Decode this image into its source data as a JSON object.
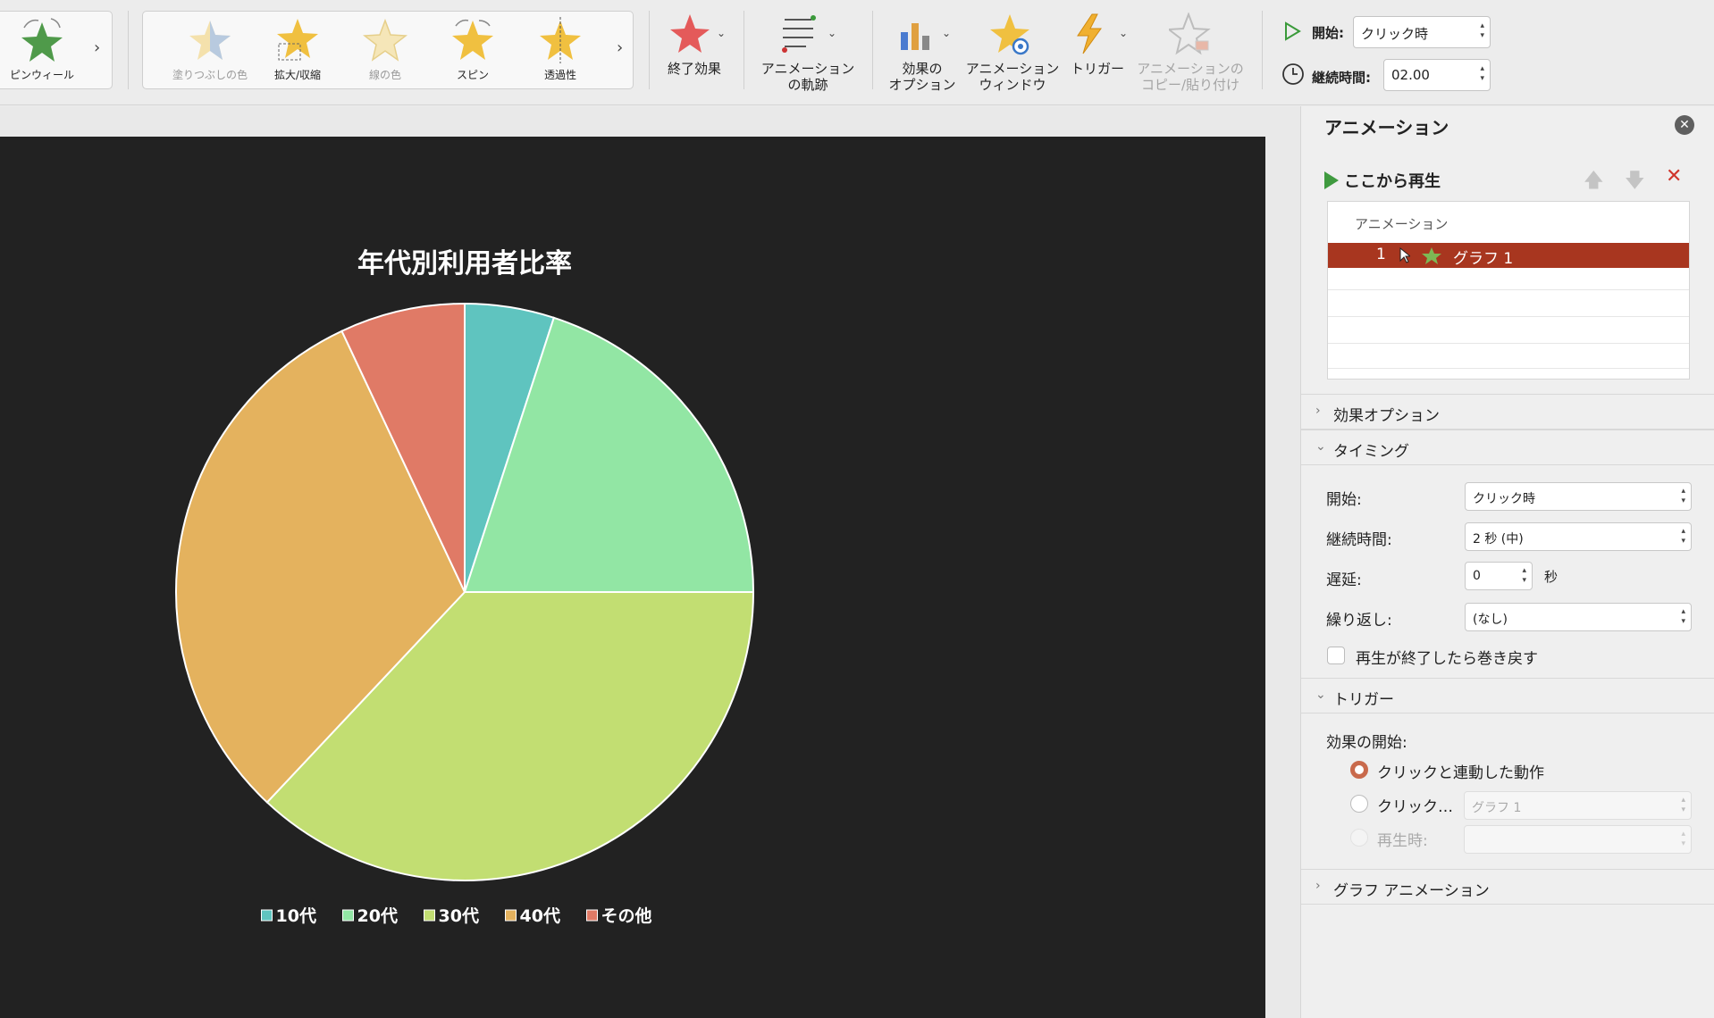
{
  "ribbon": {
    "pinwheel": {
      "label": "ピンウィール",
      "icon": "pinwheel-star-icon"
    },
    "emphasis": [
      {
        "label": "塗りつぶしの色",
        "icon": "fill-color-star-icon",
        "enabled": false
      },
      {
        "label": "拡大/収縮",
        "icon": "grow-shrink-star-icon",
        "enabled": true
      },
      {
        "label": "線の色",
        "icon": "line-color-star-icon",
        "enabled": false
      },
      {
        "label": "スピン",
        "icon": "spin-star-icon",
        "enabled": true
      },
      {
        "label": "透過性",
        "icon": "transparency-star-icon",
        "enabled": true
      }
    ],
    "exit_effect": {
      "label": "終了効果",
      "icon": "exit-star-icon"
    },
    "motion_path": {
      "label_line1": "アニメーション",
      "label_line2": "の軌跡",
      "icon": "motion-path-icon"
    },
    "effect_options": {
      "label_line1": "効果の",
      "label_line2": "オプション",
      "icon": "effect-options-chart-icon"
    },
    "animation_pane": {
      "label_line1": "アニメーション",
      "label_line2": "ウィンドウ",
      "icon": "animation-pane-star-icon"
    },
    "trigger": {
      "label": "トリガー",
      "icon": "lightning-icon"
    },
    "painter": {
      "label_line1": "アニメーションの",
      "label_line2": "コピー/貼り付け",
      "icon": "animation-painter-icon",
      "enabled": false
    },
    "start_label": "開始:",
    "start_value": "クリック時",
    "duration_label": "継続時間:",
    "duration_value": "02.00"
  },
  "slide": {
    "chart_title": "年代別利用者比率"
  },
  "chart_data": {
    "type": "pie",
    "title": "年代別利用者比率",
    "categories": [
      "10代",
      "20代",
      "30代",
      "40代",
      "その他"
    ],
    "values": [
      5,
      20,
      37,
      31,
      7
    ],
    "colors": [
      "#5fc4bf",
      "#92e6a4",
      "#c2de72",
      "#e4b25e",
      "#e07a66"
    ],
    "legend_position": "bottom",
    "start_angle_deg": 0,
    "direction": "clockwise",
    "background": "#222222",
    "text_color": "#ffffff"
  },
  "pane": {
    "title": "アニメーション",
    "play_from": "ここから再生",
    "list_header": "アニメーション",
    "selected_item": {
      "order": "1",
      "name": "グラフ 1"
    },
    "sections": {
      "effect_options": "効果オプション",
      "timing": "タイミング",
      "trigger": "トリガー",
      "chart_animation": "グラフ アニメーション"
    },
    "timing": {
      "start_label": "開始:",
      "start_value": "クリック時",
      "duration_label": "継続時間:",
      "duration_value": "2 秒 (中)",
      "delay_label": "遅延:",
      "delay_value": "0",
      "delay_unit": "秒",
      "repeat_label": "繰り返し:",
      "repeat_value": "(なし)",
      "rewind_label": "再生が終了したら巻き戻す",
      "rewind_checked": false
    },
    "trigger": {
      "start_effect_label": "効果の開始:",
      "option_click_sequence": "クリックと連動した動作",
      "option_click_on": "クリック…",
      "option_click_on_value": "グラフ 1",
      "option_play": "再生時:",
      "selected": "click_sequence"
    },
    "accent_color": "#a8361f"
  }
}
